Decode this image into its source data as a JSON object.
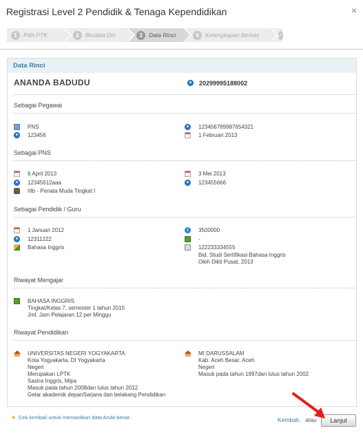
{
  "window": {
    "title": "Registrasi Level 2 Pendidik & Tenaga Kependidikan",
    "close_glyph": "×"
  },
  "wizard": {
    "steps": [
      {
        "num": "1",
        "label": "Pilih PTK"
      },
      {
        "num": "2",
        "label": "Biodata Diri"
      },
      {
        "num": "3",
        "label": "Data Rinci"
      },
      {
        "num": "4",
        "label": "Kelengkapan Berkas"
      }
    ],
    "check_glyph": "✓"
  },
  "panel": {
    "title": "Data Rinci"
  },
  "person": {
    "name": "ANANDA BADUDU",
    "nuptk": "20299995188002"
  },
  "pegawai": {
    "title": "Sebagai Pegawai",
    "status": "PNS",
    "nip": "123456",
    "id_right": "123456789987654321",
    "date": "1 Februari 2013"
  },
  "pns": {
    "title": "Sebagai PNS",
    "tmt_cpns": "6 April 2013",
    "sk_cpns": "12345612aaa",
    "golongan": "IIIb - Penata Muda Tingkat I",
    "tmt_pns": "3 Mei 2013",
    "sk_pns": "123455666"
  },
  "guru": {
    "title": "Sebagai Pendidik / Guru",
    "date": "1 Januari 2012",
    "no": "12311222",
    "bidang": "Bahasa Inggris",
    "info": "3500000",
    "dash": "-",
    "sert1": "122233334555",
    "sert2": "Bid. Studi Sertifikasi Bahasa Inggris",
    "sert3": "Oleh Dikti Pusat, 2013"
  },
  "mengajar": {
    "title": "Riwayat Mengajar",
    "l1": "BAHASA INGGRIS",
    "l2": "Tingkat/Kelas 7, semester 1 tahun 2015",
    "l3": "Jml. Jam Pelajaran 12 per Minggu"
  },
  "pendidikan": {
    "title": "Riwayat Pendidikan",
    "left": [
      "UNIVERSITAS NEGERI YOGYAKARTA",
      "Kota Yogyakarta, DI Yogyakarta",
      "Negeri",
      "Merupakan LPTK",
      "Sastra Inggris, Mipa",
      "Masuk pada tahun 2008dan lulus tahun 2012",
      "Gelar akademik depanSarjana dan belakang Pendidikan"
    ],
    "right": [
      "MI DARUSSALAM",
      "Kab. Aceh Besar, Aceh",
      "Negeri",
      "Masuk pada tahun 1997dan lulus tahun 2002"
    ]
  },
  "footer": {
    "star": "★",
    "note": "Cek kembali untuk memastikan data Anda benar.",
    "back": "Kembali,",
    "or": "atau",
    "next": "Lanjut"
  },
  "colors": {
    "accent": "#3a7ca5",
    "arrow": "#e02020"
  }
}
